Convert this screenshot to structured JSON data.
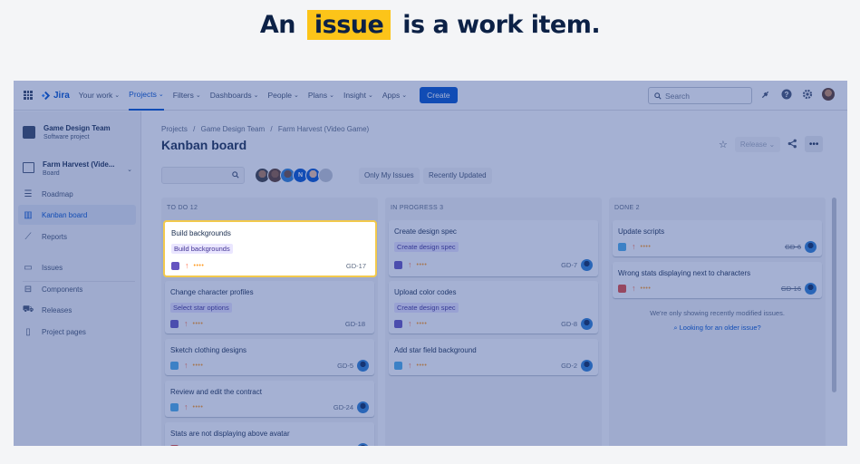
{
  "headline": {
    "before": "An",
    "highlight": "issue",
    "after": "is a work item."
  },
  "topnav": {
    "logo": "Jira",
    "items": [
      {
        "label": "Your work"
      },
      {
        "label": "Projects"
      },
      {
        "label": "Filters"
      },
      {
        "label": "Dashboards"
      },
      {
        "label": "People"
      },
      {
        "label": "Plans"
      },
      {
        "label": "Insight"
      },
      {
        "label": "Apps"
      }
    ],
    "create": "Create",
    "search_placeholder": "Search"
  },
  "sidebar": {
    "project_name": "Game Design Team",
    "project_type": "Software project",
    "board_name": "Farm Harvest (Vide...",
    "board_type": "Board",
    "items": [
      {
        "label": "Roadmap",
        "icon": "roadmap-icon"
      },
      {
        "label": "Kanban board",
        "icon": "board-icon"
      },
      {
        "label": "Reports",
        "icon": "reports-icon"
      },
      {
        "label": "Issues",
        "icon": "issues-icon"
      },
      {
        "label": "Components",
        "icon": "components-icon"
      },
      {
        "label": "Releases",
        "icon": "releases-icon"
      },
      {
        "label": "Project pages",
        "icon": "pages-icon"
      }
    ]
  },
  "breadcrumb": [
    "Projects",
    "Game Design Team",
    "Farm Harvest (Video Game)"
  ],
  "breadcrumb_sep": "/",
  "title": "Kanban board",
  "release_label": "Release",
  "filters": {
    "only_my_issues": "Only My Issues",
    "recently_updated": "Recently Updated",
    "avatar_initial": "N"
  },
  "columns": [
    {
      "header": "TO DO 12",
      "cards": [
        {
          "title": "Build backgrounds",
          "epic": "Build backgrounds",
          "type": "story",
          "priority": "↑",
          "points": "••••",
          "key": "GD-17"
        },
        {
          "title": "Change character profiles",
          "epic": "Select star options",
          "type": "story",
          "priority": "↑",
          "points": "••••",
          "key": "GD-18"
        },
        {
          "title": "Sketch clothing designs",
          "epic": "",
          "type": "task",
          "priority": "↑",
          "points": "••••",
          "key": "GD-5"
        },
        {
          "title": "Review and edit the contract",
          "epic": "",
          "type": "task",
          "priority": "↑",
          "points": "••••",
          "key": "GD-24"
        },
        {
          "title": "Stats are not displaying above avatar",
          "epic": "",
          "type": "bug",
          "priority": "↑",
          "points": "",
          "key": ""
        }
      ]
    },
    {
      "header": "IN PROGRESS 3",
      "cards": [
        {
          "title": "Create design spec",
          "epic": "Create design spec",
          "type": "story",
          "priority": "↑",
          "points": "••••",
          "key": "GD-7"
        },
        {
          "title": "Upload color codes",
          "epic": "Create design spec",
          "type": "story",
          "priority": "↑",
          "points": "••••",
          "key": "GD-8"
        },
        {
          "title": "Add star field background",
          "epic": "",
          "type": "task",
          "priority": "↑",
          "points": "••••",
          "key": "GD-2"
        }
      ]
    },
    {
      "header": "DONE 2",
      "cards": [
        {
          "title": "Update scripts",
          "epic": "",
          "type": "task",
          "priority": "↑",
          "points": "••••",
          "key": "GD-6"
        },
        {
          "title": "Wrong stats displaying next to characters",
          "epic": "",
          "type": "bug",
          "priority": "↑",
          "points": "••••",
          "key": "GD-16"
        }
      ],
      "note": "We're only showing recently modified issues.",
      "link": "Looking for an older issue?"
    }
  ],
  "colors": {
    "accent": "#0052cc",
    "highlight": "#fcc419",
    "overlay": "#2846961a"
  }
}
